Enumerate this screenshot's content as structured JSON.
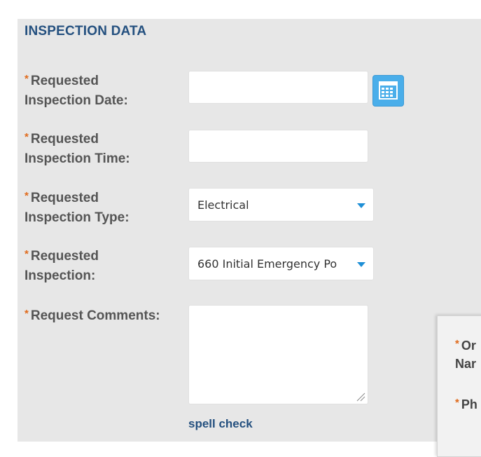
{
  "section": {
    "title": "INSPECTION DATA"
  },
  "required_marker": "*",
  "fields": {
    "date": {
      "label_line1": "Requested",
      "label_line2": "Inspection Date:",
      "value": ""
    },
    "time": {
      "label_line1": "Requested",
      "label_line2": "Inspection Time:",
      "value": ""
    },
    "type": {
      "label_line1": "Requested",
      "label_line2": "Inspection Type:",
      "selected": "Electrical"
    },
    "inspection": {
      "label_line1": "Requested",
      "label_line2": "Inspection:",
      "selected": "660 Initial Emergency Po"
    },
    "comments": {
      "label": "Request Comments:",
      "value": ""
    }
  },
  "spell_check": {
    "label": "spell check"
  },
  "overlay": {
    "line1": "Or",
    "line2": "Nar",
    "line3": "Ph"
  },
  "colors": {
    "accent": "#24507f",
    "required": "#e06a1b",
    "calendar": "#4aaeea",
    "arrow": "#1e8fd6"
  },
  "icons": {
    "calendar": "calendar-icon",
    "dropdown": "chevron-down-icon"
  }
}
